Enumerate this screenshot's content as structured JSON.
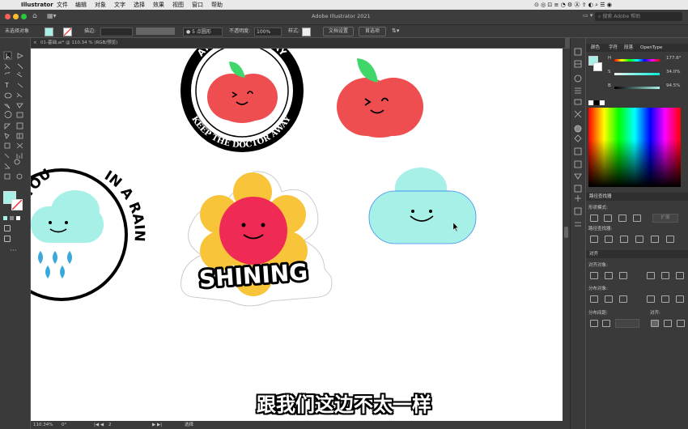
{
  "menubar": {
    "app": "Illustrator",
    "items": [
      "文件",
      "编辑",
      "对象",
      "文字",
      "选择",
      "效果",
      "视图",
      "窗口",
      "帮助"
    ]
  },
  "window": {
    "title": "Adobe Illustrator 2021",
    "search_placeholder": "搜索 Adobe 帮助"
  },
  "control": {
    "selection": "未选择对象",
    "stroke_label": "描边:",
    "brush": "5 点圆形",
    "opacity_label": "不透明度:",
    "opacity": "100%",
    "style_label": "样式:",
    "doc_setup": "文档设置",
    "prefs": "首选项"
  },
  "doc_tab": "01-基础.ai* @ 110.34 % (RGB/预览)",
  "status": {
    "zoom": "110.34%",
    "rotation": "0°",
    "artboard": "2",
    "tool": "选择"
  },
  "color_panel": {
    "tabs": [
      "颜色",
      "字符",
      "段落",
      "OpenType"
    ],
    "h_label": "H",
    "h_value": "177.6°",
    "s_label": "S",
    "s_value": "34.0%",
    "b_label": "B",
    "b_value": "94.5%"
  },
  "pathfinder": {
    "title": "路径查找器",
    "shape_modes": "形状模式:",
    "expand": "扩展",
    "pathfinders": "路径查找器:"
  },
  "align": {
    "title": "对齐",
    "align_objects": "对齐对象:",
    "distribute_objects": "分布对象:",
    "distribute_spacing": "分布间距:",
    "align_to": "对齐:"
  },
  "artwork": {
    "badge1_top": "AN APPLE A DAY",
    "badge1_bottom": "KEEP THE DOCTOR AWAY",
    "badge2_top": "SEE YOU",
    "badge2_side": "IN A RAIN",
    "badge2_letters": "Y SEE YOU IN A RA",
    "sticker_text": "SHINING"
  },
  "subtitle": "跟我们这边不太一样",
  "colors": {
    "apple_red": "#EE4E50",
    "leaf_green": "#3FD66A",
    "cloud": "#A6F0E8",
    "flower_yellow": "#F8C43A",
    "pink": "#EE2A55",
    "drop_blue": "#3AA8D8"
  }
}
